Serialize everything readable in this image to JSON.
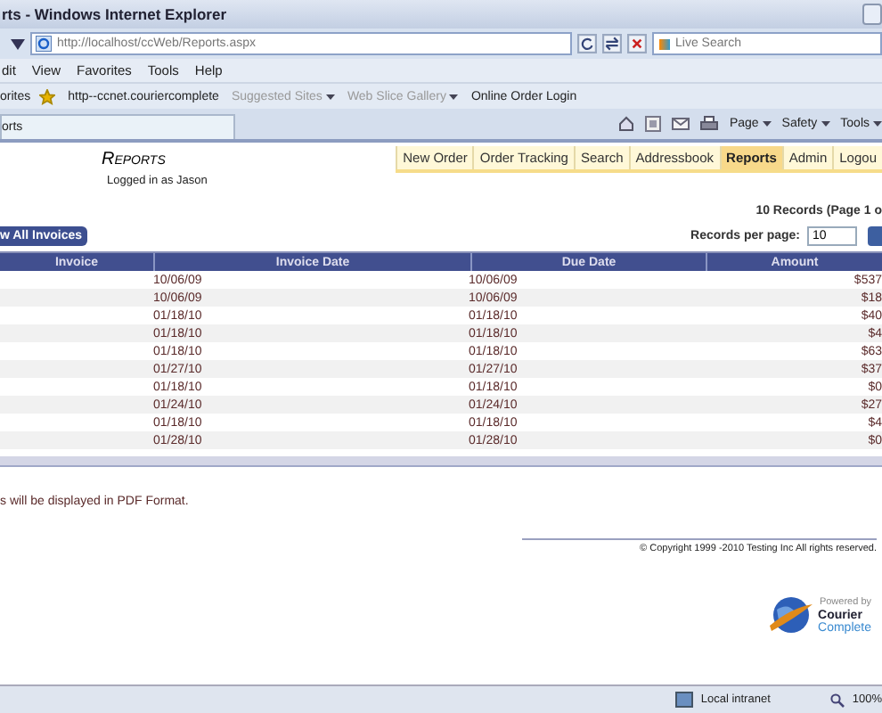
{
  "window": {
    "title": "rts - Windows Internet Explorer"
  },
  "address_bar": {
    "url": "http://localhost/ccWeb/Reports.aspx",
    "search_placeholder": "Live Search"
  },
  "menu": [
    "dit",
    "View",
    "Favorites",
    "Tools",
    "Help"
  ],
  "favorites_bar": {
    "label": "orites",
    "links": [
      {
        "label": "http--ccnet.couriercomplete",
        "disabled": false,
        "dropdown": false
      },
      {
        "label": "Suggested Sites",
        "disabled": true,
        "dropdown": true
      },
      {
        "label": "Web Slice Gallery",
        "disabled": true,
        "dropdown": true
      },
      {
        "label": "Online Order Login",
        "disabled": false,
        "dropdown": false
      }
    ]
  },
  "tab": {
    "label": "orts"
  },
  "command_bar": [
    "Page",
    "Safety",
    "Tools"
  ],
  "page": {
    "heading": "Reports",
    "user": "Logged in as Jason",
    "nav": [
      {
        "label": "New Order",
        "selected": false
      },
      {
        "label": "Order Tracking",
        "selected": false
      },
      {
        "label": "Search",
        "selected": false
      },
      {
        "label": "Addressbook",
        "selected": false
      },
      {
        "label": "Reports",
        "selected": true
      },
      {
        "label": "Admin",
        "selected": false
      },
      {
        "label": "Logou",
        "selected": false
      }
    ],
    "record_count": "10 Records (Page 1 o",
    "view_button": "w All Invoices",
    "per_page_label": "Records per page:",
    "per_page_value": "10",
    "table": {
      "columns": [
        "Invoice",
        "Invoice Date",
        "Due Date",
        "Amount"
      ],
      "rows": [
        [
          "10/06/09",
          "10/06/09",
          "$537"
        ],
        [
          "10/06/09",
          "10/06/09",
          "$18"
        ],
        [
          "01/18/10",
          "01/18/10",
          "$40"
        ],
        [
          "01/18/10",
          "01/18/10",
          "$4"
        ],
        [
          "01/18/10",
          "01/18/10",
          "$63"
        ],
        [
          "01/27/10",
          "01/27/10",
          "$37"
        ],
        [
          "01/18/10",
          "01/18/10",
          "$0"
        ],
        [
          "01/24/10",
          "01/24/10",
          "$27"
        ],
        [
          "01/18/10",
          "01/18/10",
          "$4"
        ],
        [
          "01/28/10",
          "01/28/10",
          "$0"
        ]
      ]
    },
    "note": "s will be displayed in PDF Format.",
    "copyright": "© Copyright 1999 -2010 Testing Inc All rights reserved.",
    "logo": {
      "powered": "Powered by",
      "line1": "Courier",
      "line2": "Complete"
    }
  },
  "status_bar": {
    "zone": "Local intranet",
    "zoom": "100%"
  }
}
